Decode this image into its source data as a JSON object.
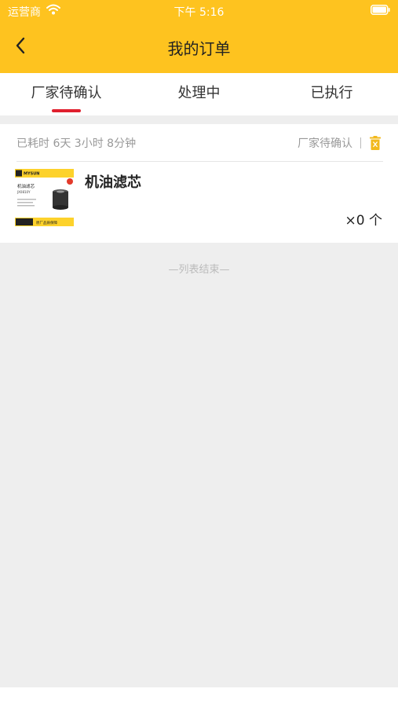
{
  "status_bar": {
    "carrier": "运营商",
    "time": "下午 5:16"
  },
  "nav": {
    "title": "我的订单"
  },
  "tabs": [
    {
      "label": "厂家待确认",
      "active": true
    },
    {
      "label": "处理中",
      "active": false
    },
    {
      "label": "已执行",
      "active": false
    }
  ],
  "order": {
    "elapsed": "已耗时 6天 3小时 8分钟",
    "status": "厂家待确认",
    "product_name": "机油滤芯",
    "quantity": "×0 个",
    "image_text": {
      "brand": "MYSUN",
      "name": "机油滤芯",
      "code": "JX0810Y",
      "badge": "原厂品质保障"
    }
  },
  "list_end": "—列表结束—",
  "colors": {
    "header": "#FEC31F",
    "indicator": "#E0202E",
    "background": "#EEEEEE"
  }
}
